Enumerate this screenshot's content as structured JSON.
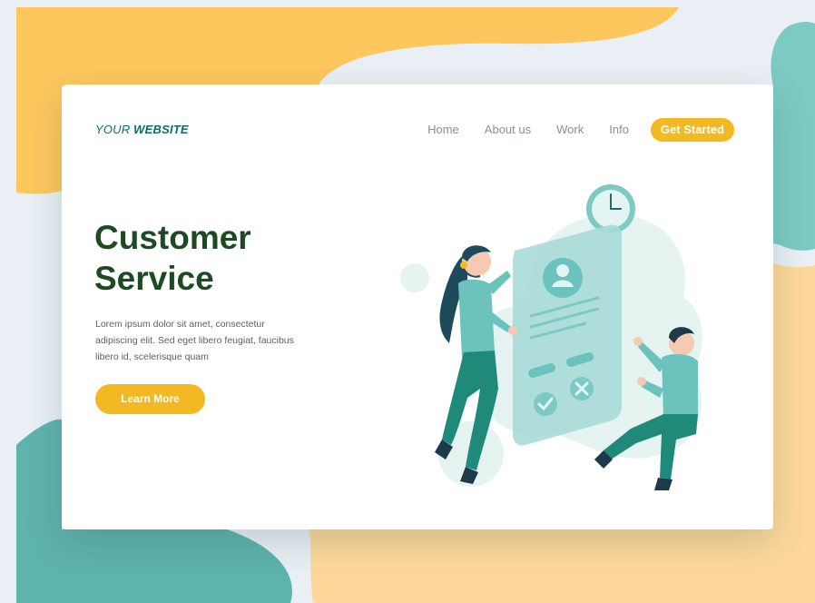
{
  "brand": {
    "prefix": "YOUR",
    "bold": "WEBSITE"
  },
  "nav": {
    "items": [
      "Home",
      "About us",
      "Work",
      "Info"
    ],
    "cta": "Get Started"
  },
  "hero": {
    "title_line1": "Customer",
    "title_line2": "Service",
    "body": "Lorem ipsum dolor sit amet, consectetur adipiscing elit. Sed eget libero feugiat, faucibus libero id, scelerisque quam",
    "button": "Learn More"
  },
  "colors": {
    "accent": "#f3b922",
    "heading": "#1d4a22",
    "brand": "#0f6a66",
    "teal": "#6cc3bd",
    "background_yellow": "#fdc75e",
    "background_cream": "#fdd89a",
    "background_light": "#e9eff4"
  },
  "icons": {
    "illustration": "customer-service-illustration",
    "clock": "clock-icon",
    "profile": "profile-avatar-icon",
    "check": "check-icon",
    "close": "close-icon"
  }
}
